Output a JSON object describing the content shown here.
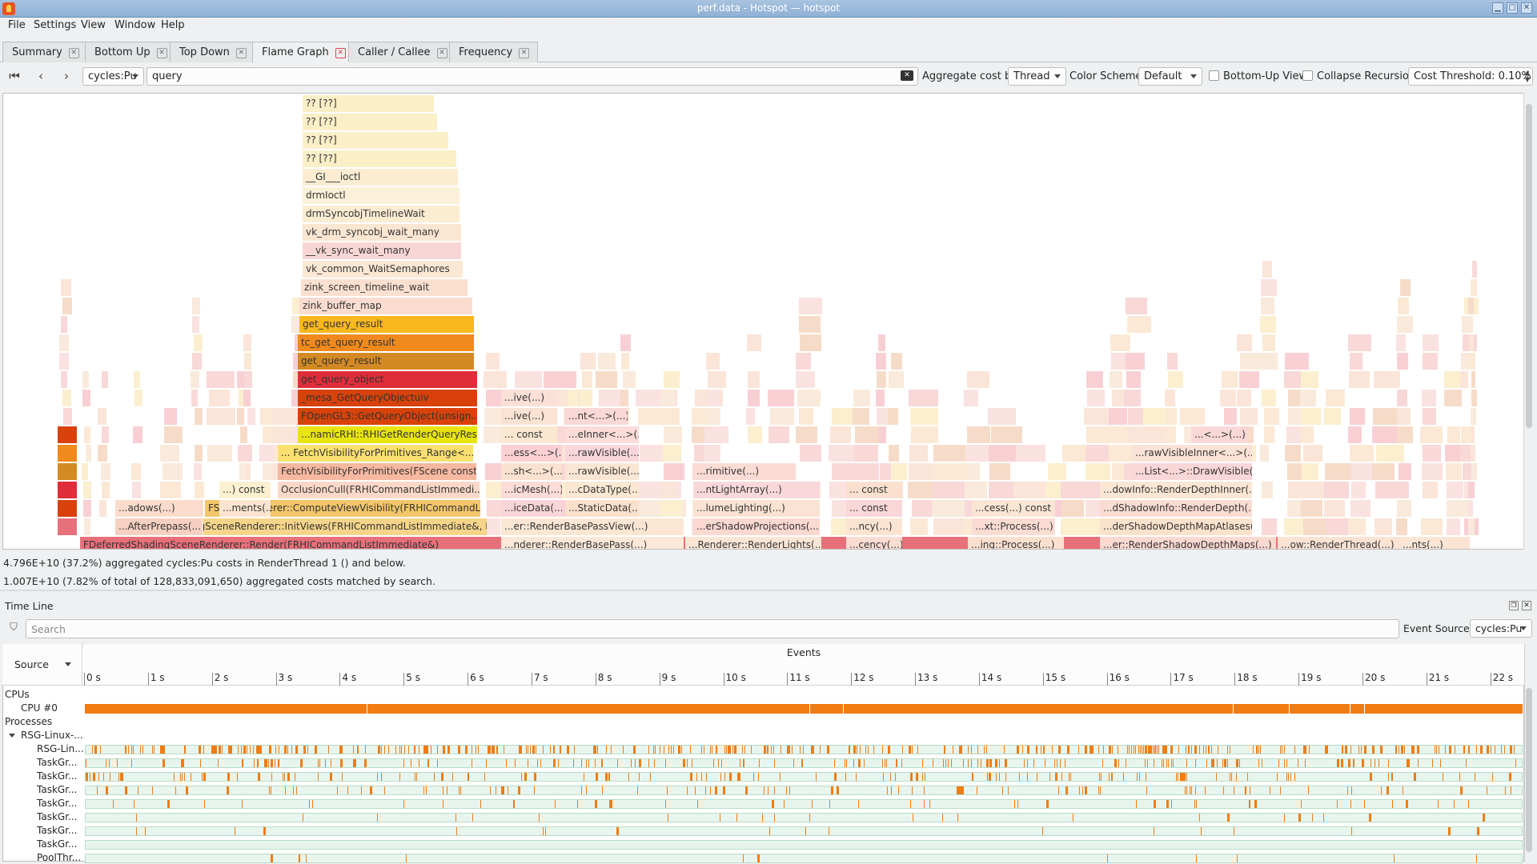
{
  "window": {
    "title": "perf.data - Hotspot — hotspot"
  },
  "menu": [
    "File",
    "Settings",
    "View",
    "Window",
    "Help"
  ],
  "tabs": [
    {
      "label": "Summary",
      "active": false
    },
    {
      "label": "Bottom Up",
      "active": false
    },
    {
      "label": "Top Down",
      "active": false
    },
    {
      "label": "Flame Graph",
      "active": true
    },
    {
      "label": "Caller / Callee",
      "active": false
    },
    {
      "label": "Frequency",
      "active": false
    }
  ],
  "toolbar": {
    "event_type": "cycles:Pu",
    "search_value": "query",
    "aggregate_label": "Aggregate cost by:",
    "aggregate_value": "Thread",
    "color_scheme_label": "Color Scheme:",
    "color_scheme_value": "Default",
    "bottom_up_label": "Bottom-Up View",
    "bottom_up_checked": false,
    "collapse_label": "Collapse Recursion",
    "collapse_checked": false,
    "cost_threshold": "Cost Threshold: 0.10%"
  },
  "flamegraph": {
    "frames": [
      {
        "label": "?? [??]",
        "color": "#fbefc8"
      },
      {
        "label": "?? [??]",
        "color": "#fbefc8"
      },
      {
        "label": "?? [??]",
        "color": "#fbefc8"
      },
      {
        "label": "?? [??]",
        "color": "#fbefc8"
      },
      {
        "label": "__GI___ioctl",
        "color": "#fbecd2"
      },
      {
        "label": "drmIoctl",
        "color": "#fbf1d8"
      },
      {
        "label": "drmSyncobjTimelineWait",
        "color": "#fbecd2"
      },
      {
        "label": "vk_drm_syncobj_wait_many",
        "color": "#fbe6d2"
      },
      {
        "label": "__vk_sync_wait_many",
        "color": "#f9d6d6"
      },
      {
        "label": "vk_common_WaitSemaphores",
        "color": "#fbe8d4"
      },
      {
        "label": "zink_screen_timeline_wait",
        "color": "#fbe0d0"
      },
      {
        "label": "zink_buffer_map",
        "color": "#fbdcd0"
      },
      {
        "label": "get_query_result",
        "color": "#f9b81e"
      },
      {
        "label": "tc_get_query_result",
        "color": "#f08a1c"
      },
      {
        "label": "get_query_result",
        "color": "#d48a24"
      },
      {
        "label": "get_query_object",
        "color": "#e02d3a"
      },
      {
        "label": "_mesa_GetQueryObjectuiv",
        "color": "#d8420a"
      },
      {
        "label": "FOpenGL3::GetQueryObject(unsign...",
        "color": "#d8420a"
      },
      {
        "label": "...namicRHI::RHIGetRenderQueryResult(...)",
        "color": "#e8e410"
      },
      {
        "label": "... FetchVisibilityForPrimitives_Range<...>(...)",
        "color": "#fbe070"
      },
      {
        "label": "FetchVisibilityForPrimitives(FScene const...",
        "color": "#f6b8a0"
      },
      {
        "label": "OcclusionCull(FRHICommandListImmedi...",
        "color": "#fbd8c8"
      },
      {
        "label": "FSceneRenderer::ComputeViewVisibility(FRHICommandList...",
        "color": "#f3c66a"
      },
      {
        "label": "FDeferredShadingSceneRenderer::InitViews(FRHICommandListImmediate&, FILC...",
        "color": "#f6d58a"
      },
      {
        "label": "FDeferredShadingSceneRenderer::Render(FRHICommandListImmediate&)",
        "color": "#e8707a"
      }
    ],
    "side_labels": [
      "...ive(...)",
      "...ive(...)",
      "...nt<...>(...)",
      "... const",
      "...eInner<...>(...)",
      "...ess<...>(...)",
      "...rawVisible(...)",
      "...sh<...>(...)",
      "...rawVisible(...)",
      "...icMesh(...)",
      "...cDataType(...)",
      "...iceData(...)",
      "...StaticData(...)",
      "...er::RenderBasePassView(...)",
      "...nderer::RenderBasePass(...)",
      "...rimitive(...)",
      "...ntLightArray(...)",
      "...lumeLighting(...)",
      "...erShadowProjections(...)",
      "...Renderer::RenderLights(...)",
      "... const",
      "... const",
      "...ncy(...)",
      "...cency(...)",
      "...cess(...) const",
      "...xt::Process(...)",
      "...ing::Process(...)",
      "...<...>(...)",
      "...rawVisibleInner<...>(...)",
      "...List<...>::DrawVisible(...)",
      "...dowInfo::RenderDepthInner(...)",
      "...dShadowInfo::RenderDepth(...)",
      "...derShadowDepthMapAtlases(...)",
      "...er::RenderShadowDepthMaps(...)",
      "...nts(...)",
      "...ow::RenderThread(...)",
      "...adows(...)",
      "...ments(...)",
      "...) const",
      "...AfterPrepass(...)"
    ]
  },
  "status": {
    "line1": "4.796E+10 (37.2%) aggregated cycles:Pu costs in RenderThread 1 () and below.",
    "line2": "1.007E+10 (7.82% of total of 128,833,091,650) aggregated costs matched by search."
  },
  "timeline": {
    "title": "Time Line",
    "search_placeholder": "Search",
    "event_source_label": "Event Source:",
    "event_source_value": "cycles:Pu",
    "source_header": "Source",
    "events_header": "Events",
    "ticks": [
      "0 s",
      "1 s",
      "2 s",
      "3 s",
      "4 s",
      "5 s",
      "6 s",
      "7 s",
      "8 s",
      "9 s",
      "10 s",
      "11 s",
      "12 s",
      "13 s",
      "14 s",
      "15 s",
      "16 s",
      "17 s",
      "18 s",
      "19 s",
      "20 s",
      "21 s",
      "22 s"
    ],
    "rows": [
      {
        "label": "CPUs",
        "kind": "group"
      },
      {
        "label": "CPU #0",
        "kind": "cpu"
      },
      {
        "label": "Processes",
        "kind": "group"
      },
      {
        "label": "RSG-Linux-...",
        "kind": "process"
      },
      {
        "label": "RSG-Lin...",
        "kind": "thread",
        "density": 0.55
      },
      {
        "label": "TaskGr...",
        "kind": "thread",
        "density": 0.28
      },
      {
        "label": "TaskGr...",
        "kind": "thread",
        "density": 0.22
      },
      {
        "label": "TaskGr...",
        "kind": "thread",
        "density": 0.16
      },
      {
        "label": "TaskGr...",
        "kind": "thread",
        "density": 0.08
      },
      {
        "label": "TaskGr...",
        "kind": "thread",
        "density": 0.04
      },
      {
        "label": "TaskGr...",
        "kind": "thread",
        "density": 0.03
      },
      {
        "label": "TaskGr...",
        "kind": "thread",
        "density": 0.0
      },
      {
        "label": "PoolThr...",
        "kind": "thread",
        "density": 0.02
      }
    ],
    "colors": {
      "cpu": "#f07c12",
      "lane": "#e8f5ee",
      "mark": "#f07c12"
    }
  }
}
